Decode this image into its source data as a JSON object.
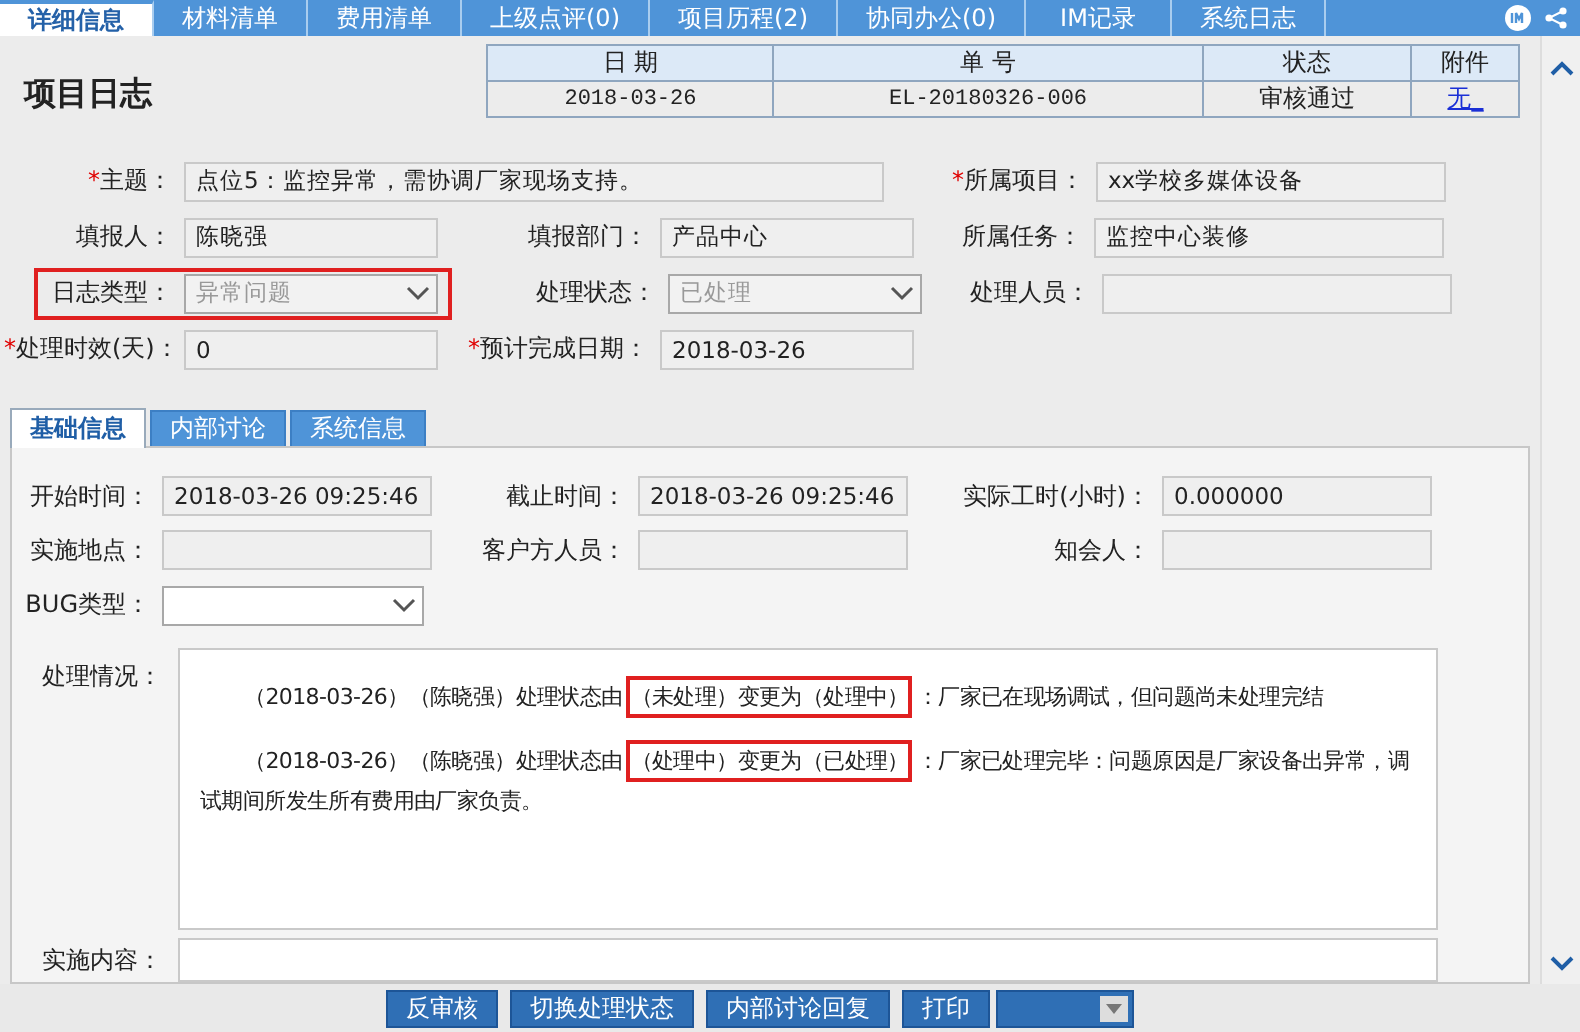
{
  "top_tabs": [
    {
      "label": "详细信息",
      "selected": true
    },
    {
      "label": "材料清单",
      "selected": false
    },
    {
      "label": "费用清单",
      "selected": false
    },
    {
      "label": "上级点评(0)",
      "selected": false
    },
    {
      "label": "项目历程(2)",
      "selected": false
    },
    {
      "label": "协同办公(0)",
      "selected": false
    },
    {
      "label": "IM记录",
      "selected": false
    },
    {
      "label": "系统日志",
      "selected": false
    }
  ],
  "page_title": "项目日志",
  "summary_table": {
    "columns": [
      "日 期",
      "单 号",
      "状态",
      "附件"
    ],
    "row": [
      {
        "text": "2018-03-26",
        "kind": "mono"
      },
      {
        "text": "EL-20180326-006",
        "kind": "mono"
      },
      {
        "text": "审核通过",
        "kind": "plain"
      },
      {
        "text": "无_",
        "kind": "link"
      }
    ]
  },
  "form_rows": [
    [
      {
        "mark": "*",
        "label": "主题：",
        "kind": "text",
        "value": "点位5：监控异常，需协调厂家现场支持。",
        "wide": true
      },
      {
        "mark": "*",
        "label": "所属项目：",
        "kind": "text",
        "value": "xx学校多媒体设备"
      }
    ],
    [
      {
        "label": "填报人：",
        "kind": "text",
        "value": "陈晓强"
      },
      {
        "label": "填报部门：",
        "kind": "text",
        "value": "产品中心"
      },
      {
        "label": "所属任务：",
        "kind": "text",
        "value": "监控中心装修"
      }
    ],
    [
      {
        "label": "日志类型：",
        "kind": "select",
        "value": "异常问题",
        "disabled": true,
        "highlighted": true
      },
      {
        "label": "处理状态：",
        "kind": "select",
        "value": "已处理",
        "disabled": true
      },
      {
        "label": "处理人员：",
        "kind": "text"
      }
    ],
    [
      {
        "mark": "*",
        "label": "处理时效(天)：",
        "kind": "text",
        "value": "0"
      },
      {
        "mark": "*",
        "label": "预计完成日期：",
        "kind": "text",
        "value": "2018-03-26"
      }
    ]
  ],
  "inner_tabs": [
    {
      "label": "基础信息",
      "selected": true
    },
    {
      "label": "内部讨论",
      "selected": false
    },
    {
      "label": "系统信息",
      "selected": false
    }
  ],
  "basic_rows": [
    [
      {
        "label": "开始时间：",
        "kind": "text",
        "value": "2018-03-26 09:25:46"
      },
      {
        "label": "截止时间：",
        "kind": "text",
        "value": "2018-03-26 09:25:46"
      },
      {
        "label": "实际工时(小时)：",
        "kind": "text",
        "value": "0.000000"
      }
    ],
    [
      {
        "label": "实施地点：",
        "kind": "text"
      },
      {
        "label": "客户方人员：",
        "kind": "text"
      },
      {
        "label": "知会人：",
        "kind": "text"
      }
    ],
    [
      {
        "label": "BUG类型：",
        "kind": "select"
      }
    ]
  ],
  "processing": {
    "label": "处理情况：",
    "entries": [
      {
        "before": "（2018-03-26）（陈晓强）处理状态由",
        "highlight": "（未处理）变更为（处理中）",
        "after": "：厂家已在现场调试，但问题尚未处理完结"
      },
      {
        "before": "（2018-03-26）（陈晓强）处理状态由",
        "highlight": "（处理中）变更为（已处理）",
        "after": "：厂家已处理完毕：问题原因是厂家设备出异常，调试期间所发生所有费用由厂家负责。"
      }
    ]
  },
  "implementation": {
    "label": "实施内容："
  },
  "toolbar": {
    "buttons": [
      "反审核",
      "切换处理状态",
      "内部讨论回复",
      "打印"
    ]
  }
}
